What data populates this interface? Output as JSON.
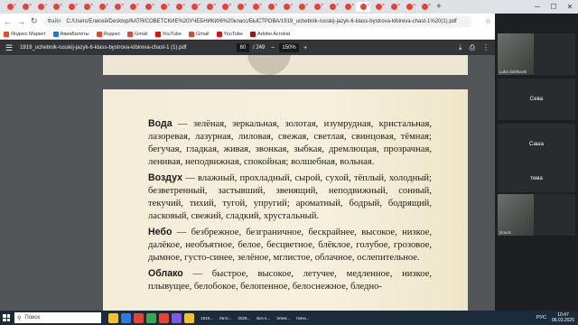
{
  "browser": {
    "tabs": [
      {
        "color": "#e94235",
        "active": false
      },
      {
        "color": "#e94235",
        "active": false
      },
      {
        "color": "#e94235",
        "active": false
      },
      {
        "color": "#e94235",
        "active": false
      },
      {
        "color": "#e94235",
        "active": false
      },
      {
        "color": "#e94235",
        "active": false
      },
      {
        "color": "#e94235",
        "active": false
      },
      {
        "color": "#e94235",
        "active": false
      },
      {
        "color": "#e94235",
        "active": false
      },
      {
        "color": "#e94235",
        "active": false
      },
      {
        "color": "#e94235",
        "active": false
      },
      {
        "color": "#e94235",
        "active": false
      },
      {
        "color": "#e94235",
        "active": false
      },
      {
        "color": "#e94235",
        "active": false
      },
      {
        "color": "#e94235",
        "active": false
      },
      {
        "color": "#e94235",
        "active": false
      },
      {
        "color": "#e94235",
        "active": false
      },
      {
        "color": "#e94235",
        "active": false
      },
      {
        "color": "#e94235",
        "active": false
      },
      {
        "color": "#e94235",
        "active": false
      },
      {
        "color": "#e94235",
        "active": false
      },
      {
        "color": "#e94235",
        "active": false
      },
      {
        "color": "#e94235",
        "active": false
      },
      {
        "color": "#e94235",
        "active": true
      },
      {
        "color": "#e94235",
        "active": false
      },
      {
        "color": "#e94235",
        "active": false
      },
      {
        "color": "#e94235",
        "active": false
      },
      {
        "color": "#e94235",
        "active": false
      }
    ],
    "url_label": "Файл",
    "url": "C:/Users/Елисей/Desktop/КАТЯ/СОВЕТСКИЕ%20УЧЕБНИКИ/6%20класс/БЫСТРОВА/1919_uchebnik-russkij-jazyk-6-klass-bystrova-kibireva-chast-1%20(1).pdf",
    "bookmarks": [
      {
        "label": "Яндекс Маркет",
        "color": "#fc3f1d"
      },
      {
        "label": "АвиаБилеты",
        "color": "#1a73e8"
      },
      {
        "label": "Яндекс",
        "color": "#fc3f1d"
      },
      {
        "label": "Gmail",
        "color": "#ea4335"
      },
      {
        "label": "YouTube",
        "color": "#ff0000"
      },
      {
        "label": "Gmail",
        "color": "#ea4335"
      },
      {
        "label": "YouTube",
        "color": "#ff0000"
      },
      {
        "label": "Adobe Acrobat",
        "color": "#b30b00"
      }
    ]
  },
  "pdf": {
    "filename": "1919_uchebnik-russkij-jazyk-6-klass-bystrova-kibireva-chast-1 (1).pdf",
    "page_current": "60",
    "page_total": "/ 249",
    "zoom": "150%",
    "paragraphs": [
      {
        "head": "Вода",
        "text": " — зелёная, зеркальная, золотая, изумрудная, кристальная, лазоревая, лазурная, лиловая, свежая, светлая, свинцовая, тёмная; бегучая, гладкая, живая, звонкая, зыбкая, дремлющая, прозрачная, ленивая, неподвижная, спокойная; волшебная, вольная."
      },
      {
        "head": "Воздух",
        "text": " — влажный, прохладный, сырой, сухой, тёплый, холодный; безветренный, застывший, звенящий, неподвижный, сонный, текучий, тихий, тугой, упругий; ароматный, бодрый, бодрящий, ласковый, свежий, сладкий, хрустальный."
      },
      {
        "head": "Небо",
        "text": " — безбрежное, безграничное, бескрайнее, высокое, низкое, далёкое, необъятное, белое, бесцветное, блёклое, голубое, грозовое, дымное, густо-синее, зелёное, мглистое, облачное, ослепительное."
      },
      {
        "head": "Облако",
        "text": " — быстрое, высокое, летучее, медленное, низкое, плывущее, белобокое, белопенное, белоснежное, бледно-"
      }
    ]
  },
  "video_panel": {
    "tiles": [
      {
        "label": "",
        "caption": "Luka Sdelkavik"
      },
      {
        "label": "Сева",
        "caption": ""
      },
      {
        "label": "Саша",
        "caption": ""
      },
      {
        "label": "тема",
        "caption": ""
      },
      {
        "label": "",
        "caption": "Илья1"
      }
    ]
  },
  "taskbar": {
    "search_placeholder": "Поиск",
    "apps": [
      "1919...",
      "Лите...",
      "2025...",
      "Без н...",
      "Элем...",
      "Нача..."
    ],
    "lang": "РУС",
    "time": "10:47",
    "date": "06.03.2025"
  }
}
